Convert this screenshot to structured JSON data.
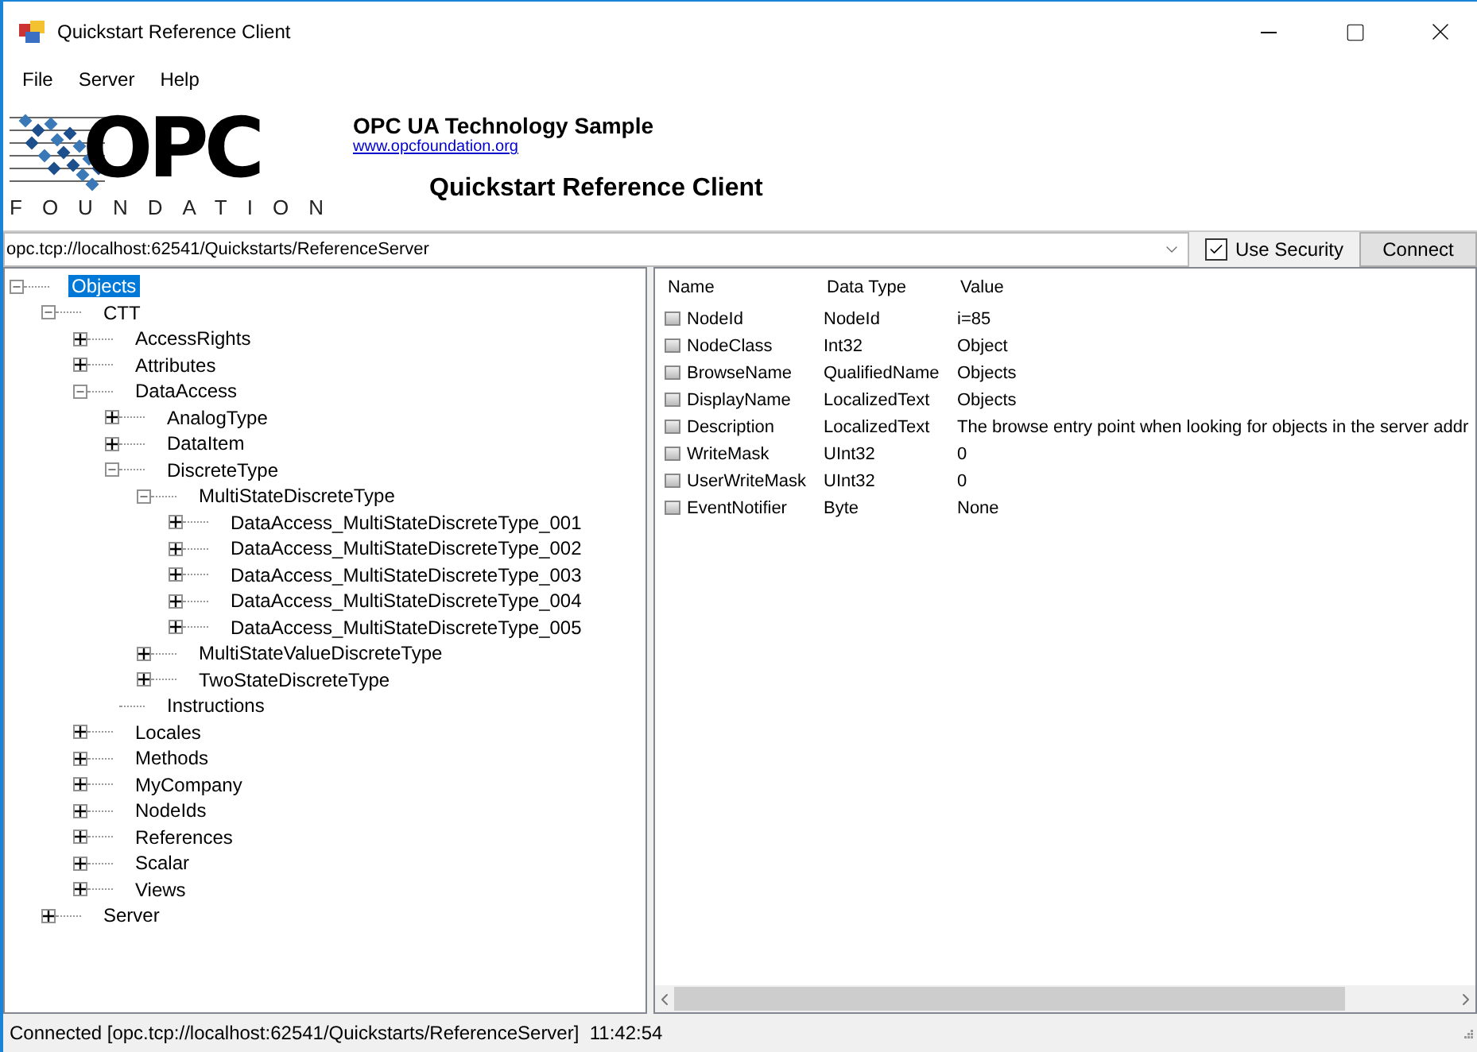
{
  "window": {
    "title": "Quickstart Reference Client"
  },
  "menu": [
    "File",
    "Server",
    "Help"
  ],
  "banner": {
    "logo_mark": "OPC",
    "logo_caption": "FOUNDATION",
    "heading": "OPC UA Technology Sample",
    "link": "www.opcfoundation.org",
    "subtitle": "Quickstart Reference Client"
  },
  "connection": {
    "url": "opc.tcp://localhost:62541/Quickstarts/ReferenceServer",
    "use_security": {
      "label": "Use Security",
      "checked": true
    },
    "button": "Connect"
  },
  "tree": [
    {
      "label": "Objects",
      "selected": true,
      "expanded": true,
      "children": [
        {
          "label": "CTT",
          "selected": false,
          "expanded": true,
          "children": [
            {
              "label": "AccessRights",
              "selected": false,
              "expanded": false
            },
            {
              "label": "Attributes",
              "selected": false,
              "expanded": false
            },
            {
              "label": "DataAccess",
              "selected": false,
              "expanded": true,
              "children": [
                {
                  "label": "AnalogType",
                  "selected": false,
                  "expanded": false
                },
                {
                  "label": "DataItem",
                  "selected": false,
                  "expanded": false
                },
                {
                  "label": "DiscreteType",
                  "selected": false,
                  "expanded": true,
                  "children": [
                    {
                      "label": "MultiStateDiscreteType",
                      "selected": false,
                      "expanded": true,
                      "children": [
                        {
                          "label": "DataAccess_MultiStateDiscreteType_001",
                          "selected": false,
                          "expanded": false
                        },
                        {
                          "label": "DataAccess_MultiStateDiscreteType_002",
                          "selected": false,
                          "expanded": false
                        },
                        {
                          "label": "DataAccess_MultiStateDiscreteType_003",
                          "selected": false,
                          "expanded": false
                        },
                        {
                          "label": "DataAccess_MultiStateDiscreteType_004",
                          "selected": false,
                          "expanded": false
                        },
                        {
                          "label": "DataAccess_MultiStateDiscreteType_005",
                          "selected": false,
                          "expanded": false
                        }
                      ]
                    },
                    {
                      "label": "MultiStateValueDiscreteType",
                      "selected": false,
                      "expanded": false
                    },
                    {
                      "label": "TwoStateDiscreteType",
                      "selected": false,
                      "expanded": false
                    }
                  ]
                },
                {
                  "label": "Instructions",
                  "selected": false
                }
              ]
            },
            {
              "label": "Locales",
              "selected": false,
              "expanded": false
            },
            {
              "label": "Methods",
              "selected": false,
              "expanded": false
            },
            {
              "label": "MyCompany",
              "selected": false,
              "expanded": false
            },
            {
              "label": "NodeIds",
              "selected": false,
              "expanded": false
            },
            {
              "label": "References",
              "selected": false,
              "expanded": false
            },
            {
              "label": "Scalar",
              "selected": false,
              "expanded": false
            },
            {
              "label": "Views",
              "selected": false,
              "expanded": false
            }
          ]
        },
        {
          "label": "Server",
          "selected": false,
          "expanded": false
        }
      ]
    }
  ],
  "attributes": {
    "columns": [
      "Name",
      "Data Type",
      "Value"
    ],
    "rows": [
      [
        "NodeId",
        "NodeId",
        "i=85"
      ],
      [
        "NodeClass",
        "Int32",
        "Object"
      ],
      [
        "BrowseName",
        "QualifiedName",
        "Objects"
      ],
      [
        "DisplayName",
        "LocalizedText",
        "Objects"
      ],
      [
        "Description",
        "LocalizedText",
        "The browse entry point when looking for objects in the server addr"
      ],
      [
        "WriteMask",
        "UInt32",
        "0"
      ],
      [
        "UserWriteMask",
        "UInt32",
        "0"
      ],
      [
        "EventNotifier",
        "Byte",
        "None"
      ]
    ]
  },
  "status_bar": {
    "text": "Connected [opc.tcp://localhost:62541/Quickstarts/ReferenceServer]  11:42:54"
  }
}
